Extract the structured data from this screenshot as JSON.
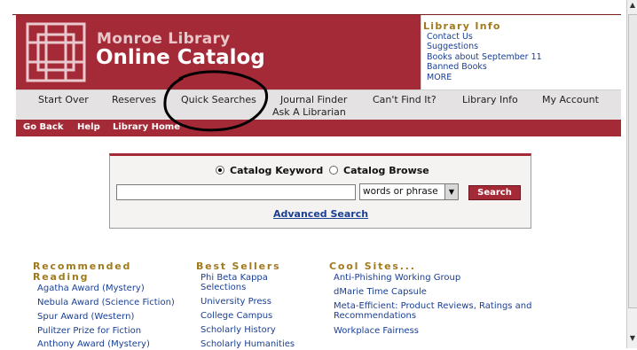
{
  "header": {
    "title_line1": "Monroe Library",
    "title_line2": "Online Catalog",
    "colors": {
      "brand_red": "#a42a37",
      "gold": "#a07a1d",
      "link_blue": "#1a3f93"
    }
  },
  "library_info": {
    "heading": "Library Info",
    "links": [
      "Contact Us",
      "Suggestions",
      "Books about September 11",
      "Banned Books",
      "MORE"
    ]
  },
  "nav": {
    "items": [
      "Start Over",
      "Reserves",
      "Quick Searches",
      "Journal Finder",
      "Can't Find It?",
      "Library Info",
      "My Account"
    ],
    "ask": "Ask A Librarian"
  },
  "redbar": {
    "links": [
      "Go Back",
      "Help",
      "Library Home"
    ]
  },
  "search": {
    "radio_keyword": "Catalog Keyword",
    "radio_browse": "Catalog Browse",
    "selected": "Catalog Keyword",
    "input_value": "",
    "select_value": "words or phrase",
    "button": "Search",
    "advanced": "Advanced Search"
  },
  "columns": {
    "recommended": {
      "heading_line1": "Recommended",
      "heading_line2": "Reading",
      "links": [
        "Agatha Award (Mystery)",
        "Nebula Award (Science Fiction)",
        "Spur Award (Western)",
        "Pulitzer Prize for Fiction",
        "Anthony Award (Mystery)"
      ]
    },
    "bestsellers": {
      "heading": "Best Sellers",
      "links": [
        "Phi Beta Kappa",
        "Selections",
        "University Press",
        "College Campus",
        "Scholarly History",
        "Scholarly Humanities"
      ]
    },
    "coolsites": {
      "heading": "Cool Sites...",
      "links": [
        "Anti-Phishing Working Group",
        "dMarie Time Capsule",
        "Meta-Efficient: Product Reviews, Ratings and",
        "Recommendations",
        "Workplace Fairness"
      ]
    }
  }
}
